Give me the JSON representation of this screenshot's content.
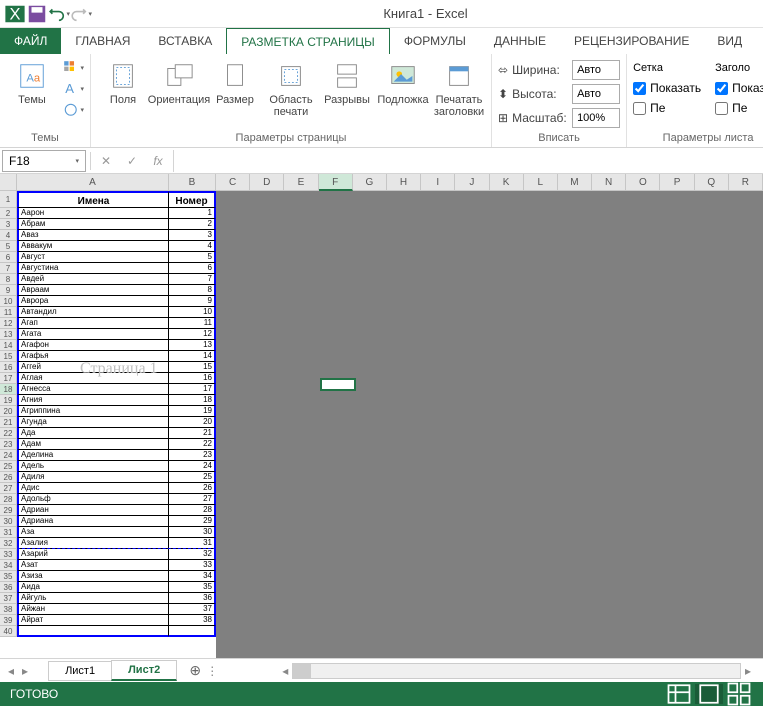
{
  "app": {
    "title": "Книга1 - Excel"
  },
  "tabs": {
    "file": "ФАЙЛ",
    "home": "ГЛАВНАЯ",
    "insert": "ВСТАВКА",
    "layout": "РАЗМЕТКА СТРАНИЦЫ",
    "formulas": "ФОРМУЛЫ",
    "data": "ДАННЫЕ",
    "review": "РЕЦЕНЗИРОВАНИЕ",
    "view": "ВИД"
  },
  "ribbon": {
    "themes": {
      "label": "Темы",
      "btn": "Темы"
    },
    "page_setup": {
      "label": "Параметры страницы",
      "margins": "Поля",
      "orientation": "Ориентация",
      "size": "Размер",
      "print_area": "Область\nпечати",
      "breaks": "Разрывы",
      "background": "Подложка",
      "titles": "Печатать\nзаголовки"
    },
    "scale": {
      "label": "Вписать",
      "width": "Ширина:",
      "height": "Высота:",
      "scale": "Масштаб:",
      "auto": "Авто",
      "pct": "100%"
    },
    "sheet_opts": {
      "label": "Параметры листа",
      "grid": "Сетка",
      "headings": "Заголо",
      "show": "Показать",
      "print": "Пе"
    }
  },
  "namebox": "F18",
  "columns": [
    "A",
    "B",
    "C",
    "D",
    "E",
    "F",
    "G",
    "H",
    "I",
    "J",
    "K",
    "L",
    "M",
    "N",
    "O",
    "P",
    "Q",
    "R"
  ],
  "header": {
    "a": "Имена",
    "b": "Номер"
  },
  "data_rows": [
    {
      "a": "Аарон",
      "b": "1"
    },
    {
      "a": "Абрам",
      "b": "2"
    },
    {
      "a": "Аваз",
      "b": "3"
    },
    {
      "a": "Аввакум",
      "b": "4"
    },
    {
      "a": "Август",
      "b": "5"
    },
    {
      "a": "Августина",
      "b": "6"
    },
    {
      "a": "Авдей",
      "b": "7"
    },
    {
      "a": "Авраам",
      "b": "8"
    },
    {
      "a": "Аврора",
      "b": "9"
    },
    {
      "a": "Автандил",
      "b": "10"
    },
    {
      "a": "Агап",
      "b": "11"
    },
    {
      "a": "Агата",
      "b": "12"
    },
    {
      "a": "Агафон",
      "b": "13"
    },
    {
      "a": "Агафья",
      "b": "14"
    },
    {
      "a": "Аггей",
      "b": "15"
    },
    {
      "a": "Аглая",
      "b": "16"
    },
    {
      "a": "Агнесса",
      "b": "17"
    },
    {
      "a": "Агния",
      "b": "18"
    },
    {
      "a": "Агриппина",
      "b": "19"
    },
    {
      "a": "Агунда",
      "b": "20"
    },
    {
      "a": "Ада",
      "b": "21"
    },
    {
      "a": "Адам",
      "b": "22"
    },
    {
      "a": "Аделина",
      "b": "23"
    },
    {
      "a": "Адель",
      "b": "24"
    },
    {
      "a": "Адиля",
      "b": "25"
    },
    {
      "a": "Адис",
      "b": "26"
    },
    {
      "a": "Адольф",
      "b": "27"
    },
    {
      "a": "Адриан",
      "b": "28"
    },
    {
      "a": "Адриана",
      "b": "29"
    },
    {
      "a": "Аза",
      "b": "30"
    },
    {
      "a": "Азалия",
      "b": "31"
    },
    {
      "a": "Азарий",
      "b": "32"
    },
    {
      "a": "Азат",
      "b": "33"
    },
    {
      "a": "Азиза",
      "b": "34"
    },
    {
      "a": "Аида",
      "b": "35"
    },
    {
      "a": "Айгуль",
      "b": "36"
    },
    {
      "a": "Айжан",
      "b": "37"
    },
    {
      "a": "Айрат",
      "b": "38"
    }
  ],
  "watermark": "Страница 1",
  "sheets": {
    "s1": "Лист1",
    "s2": "Лист2"
  },
  "status": "ГОТОВО"
}
